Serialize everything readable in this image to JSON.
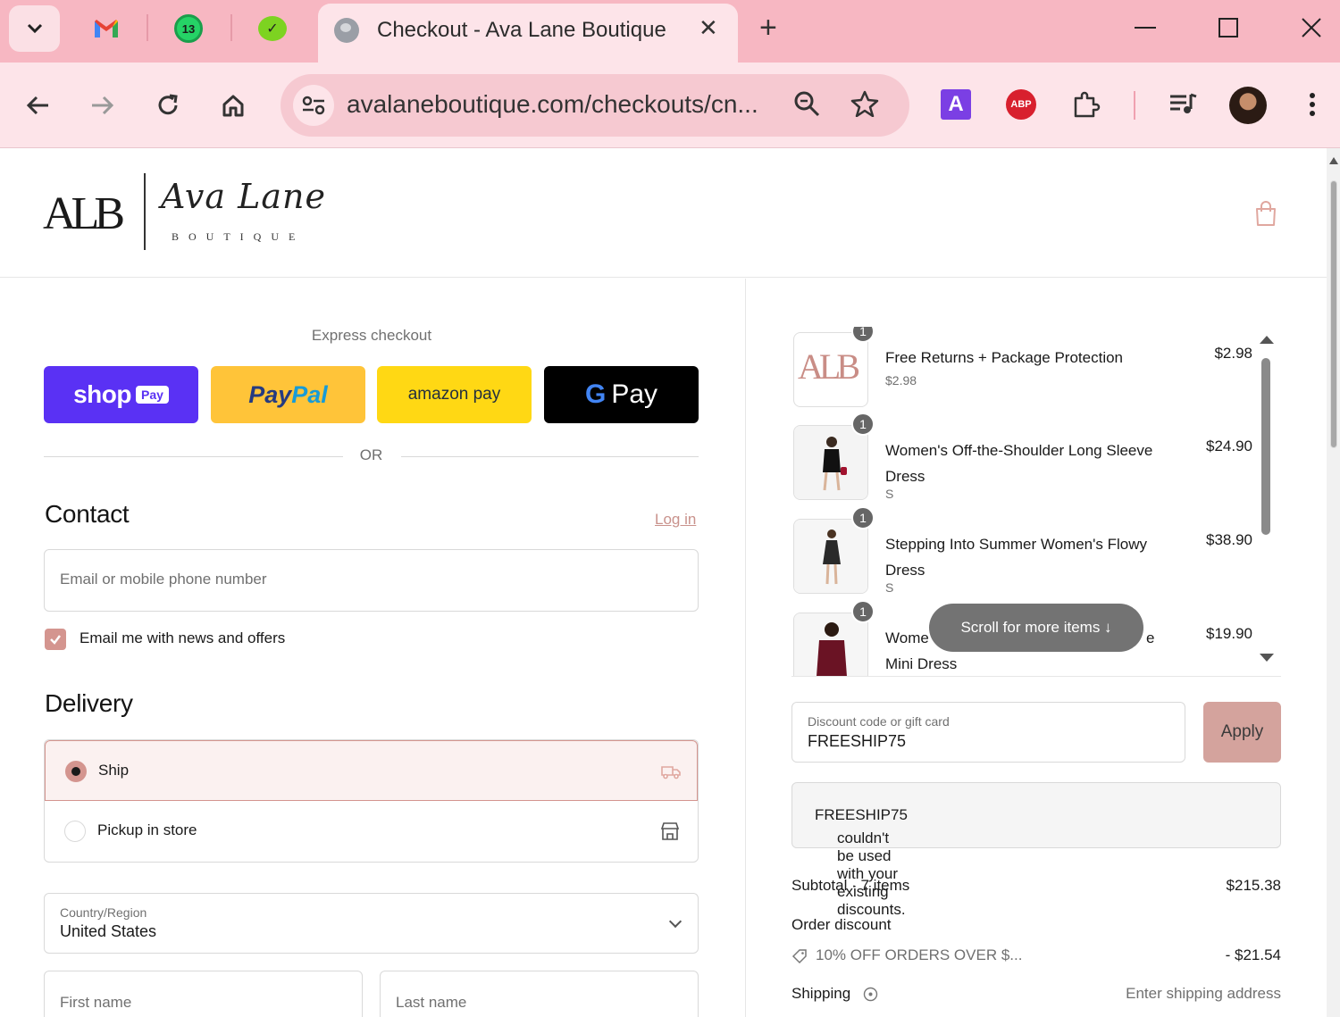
{
  "browser": {
    "tab_title": "Checkout - Ava Lane Boutique",
    "pinned_badge": "13",
    "url": "avalaneboutique.com/checkouts/cn...",
    "ext_a_label": "A",
    "ext_abp_label": "ABP"
  },
  "logo": {
    "monogram": "ALB",
    "script": "Ava Lane",
    "subtitle": "BOUTIQUE"
  },
  "express": {
    "label": "Express checkout",
    "shop_label": "shop",
    "shop_badge": "Pay",
    "paypal_pay": "Pay",
    "paypal_pal": "Pal",
    "amazon_label": "amazon pay",
    "gpay_g": "G",
    "gpay_label": "Pay",
    "or": "OR"
  },
  "contact": {
    "heading": "Contact",
    "login": "Log in",
    "email_placeholder": "Email or mobile phone number",
    "newsletter_label": "Email me with news and offers",
    "newsletter_checked": true
  },
  "delivery": {
    "heading": "Delivery",
    "options": [
      {
        "label": "Ship",
        "selected": true
      },
      {
        "label": "Pickup in store",
        "selected": false
      }
    ],
    "country_label": "Country/Region",
    "country_value": "United States",
    "first_name_placeholder": "First name",
    "last_name_placeholder": "Last name"
  },
  "cart": {
    "items": [
      {
        "qty": "1",
        "name": "Free Returns + Package Protection",
        "variant": "$2.98",
        "price": "$2.98"
      },
      {
        "qty": "1",
        "name": "Women's Off-the-Shoulder Long Sleeve Dress",
        "variant": "S",
        "price": "$24.90"
      },
      {
        "qty": "1",
        "name": "Stepping Into Summer Women's Flowy Dress",
        "variant": "S",
        "price": "$38.90"
      },
      {
        "qty": "1",
        "name": "Wome",
        "name_tail": "e",
        "name_line2": "Mini Dress",
        "price": "$19.90"
      }
    ],
    "scroll_hint": "Scroll for more items ↓",
    "discount_label": "Discount code or gift card",
    "discount_value": "FREESHIP75",
    "apply": "Apply",
    "error_code": "FREESHIP75",
    "error_text": " couldn't be used with your existing discounts."
  },
  "summary": {
    "subtotal_label": "Subtotal · 7 items",
    "subtotal_value": "$215.38",
    "order_discount_label": "Order discount",
    "discount_name": "10% OFF ORDERS OVER $...",
    "discount_value": "- $21.54",
    "shipping_label": "Shipping",
    "shipping_value": "Enter shipping address"
  },
  "colors": {
    "tabbar": "#f7b7c2",
    "toolbar": "#fde4e9",
    "accent": "#d4958f",
    "shop_pay": "#5a31f4",
    "paypal": "#ffc439",
    "amazon": "#ffd814"
  }
}
